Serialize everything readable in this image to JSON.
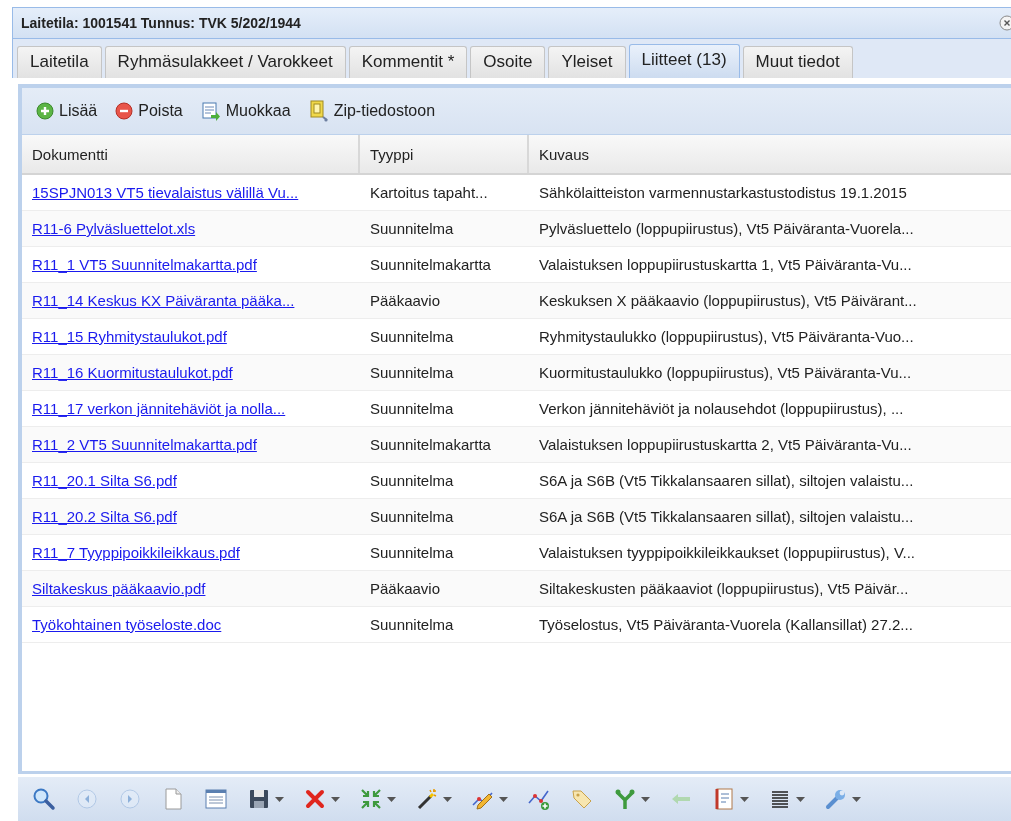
{
  "window": {
    "title": "Laitetila: 1001541 Tunnus: TVK 5/202/1944"
  },
  "tabs": [
    {
      "label": "Laitetila",
      "selected": false
    },
    {
      "label": "Ryhmäsulakkeet / Varokkeet",
      "selected": false
    },
    {
      "label": "Kommentit *",
      "selected": false
    },
    {
      "label": "Osoite",
      "selected": false
    },
    {
      "label": "Yleiset",
      "selected": false
    },
    {
      "label": "Liitteet (13)",
      "selected": true
    },
    {
      "label": "Muut tiedot",
      "selected": false
    }
  ],
  "toolbar": [
    {
      "kind": "add",
      "label": "Lisää"
    },
    {
      "kind": "remove",
      "label": "Poista"
    },
    {
      "kind": "edit",
      "label": "Muokkaa"
    },
    {
      "kind": "zip",
      "label": "Zip-tiedostoon"
    }
  ],
  "table": {
    "columns": [
      "Dokumentti",
      "Tyyppi",
      "Kuvaus"
    ],
    "rows": [
      [
        "15SPJN013 VT5 tievalaistus välillä Vu...",
        "Kartoitus tapaht...",
        "Sähkölaitteiston varmennustarkastustodistus 19.1.2015"
      ],
      [
        "R11-6 Pylväsluettelot.xls",
        "Suunnitelma",
        "Pylväsluettelo (loppupiirustus), Vt5 Päiväranta-Vuorela..."
      ],
      [
        "R11_1 VT5 Suunnitelmakartta.pdf",
        "Suunnitelmakartta",
        "Valaistuksen loppupiirustuskartta 1, Vt5 Päiväranta-Vu..."
      ],
      [
        "R11_14 Keskus KX Päiväranta pääka...",
        "Pääkaavio",
        "Keskuksen X pääkaavio (loppupiirustus), Vt5 Päivärant..."
      ],
      [
        "R11_15 Ryhmitystaulukot.pdf",
        "Suunnitelma",
        "Ryhmitystaulukko (loppupiirustus), Vt5 Päiväranta-Vuo..."
      ],
      [
        "R11_16 Kuormitustaulukot.pdf",
        "Suunnitelma",
        "Kuormitustaulukko (loppupiirustus), Vt5 Päiväranta-Vu..."
      ],
      [
        "R11_17 verkon jännitehäviöt ja nolla...",
        "Suunnitelma",
        "Verkon jännitehäviöt ja nolausehdot (loppupiirustus), ..."
      ],
      [
        "R11_2 VT5 Suunnitelmakartta.pdf",
        "Suunnitelmakartta",
        "Valaistuksen loppupiirustuskartta 2, Vt5 Päiväranta-Vu..."
      ],
      [
        "R11_20.1 Silta S6.pdf",
        "Suunnitelma",
        "S6A ja S6B (Vt5 Tikkalansaaren sillat), siltojen valaistu..."
      ],
      [
        "R11_20.2 Silta S6.pdf",
        "Suunnitelma",
        "S6A ja S6B (Vt5 Tikkalansaaren sillat), siltojen valaistu..."
      ],
      [
        "R11_7 Tyyppipoikkileikkaus.pdf",
        "Suunnitelma",
        "Valaistuksen tyyppipoikkileikkaukset (loppupiirustus), V..."
      ],
      [
        "Siltakeskus pääkaavio.pdf",
        "Pääkaavio",
        "Siltakeskusten pääkaaviot (loppupiirustus), Vt5 Päivär..."
      ],
      [
        "Työkohtainen työseloste.doc",
        "Suunnitelma",
        "Työselostus, Vt5 Päiväranta-Vuorela (Kallansillat) 27.2..."
      ]
    ]
  },
  "bottom_toolbar": [
    {
      "kind": "search",
      "menu": false,
      "disabled": false
    },
    {
      "kind": "back",
      "menu": false,
      "disabled": true
    },
    {
      "kind": "forward",
      "menu": false,
      "disabled": true
    },
    {
      "kind": "page",
      "menu": false,
      "disabled": false
    },
    {
      "kind": "list",
      "menu": false,
      "disabled": false
    },
    {
      "kind": "save",
      "menu": true,
      "disabled": false
    },
    {
      "kind": "delete",
      "menu": true,
      "disabled": false
    },
    {
      "kind": "shrink",
      "menu": true,
      "disabled": false
    },
    {
      "kind": "wand",
      "menu": true,
      "disabled": false
    },
    {
      "kind": "pencil",
      "menu": true,
      "disabled": false
    },
    {
      "kind": "nodes",
      "menu": false,
      "disabled": false
    },
    {
      "kind": "tag",
      "menu": false,
      "disabled": false
    },
    {
      "kind": "fork",
      "menu": true,
      "disabled": false
    },
    {
      "kind": "arrow",
      "menu": false,
      "disabled": true
    },
    {
      "kind": "notebook",
      "menu": true,
      "disabled": false
    },
    {
      "kind": "lines",
      "menu": true,
      "disabled": false
    },
    {
      "kind": "wrench",
      "menu": true,
      "disabled": false
    }
  ]
}
